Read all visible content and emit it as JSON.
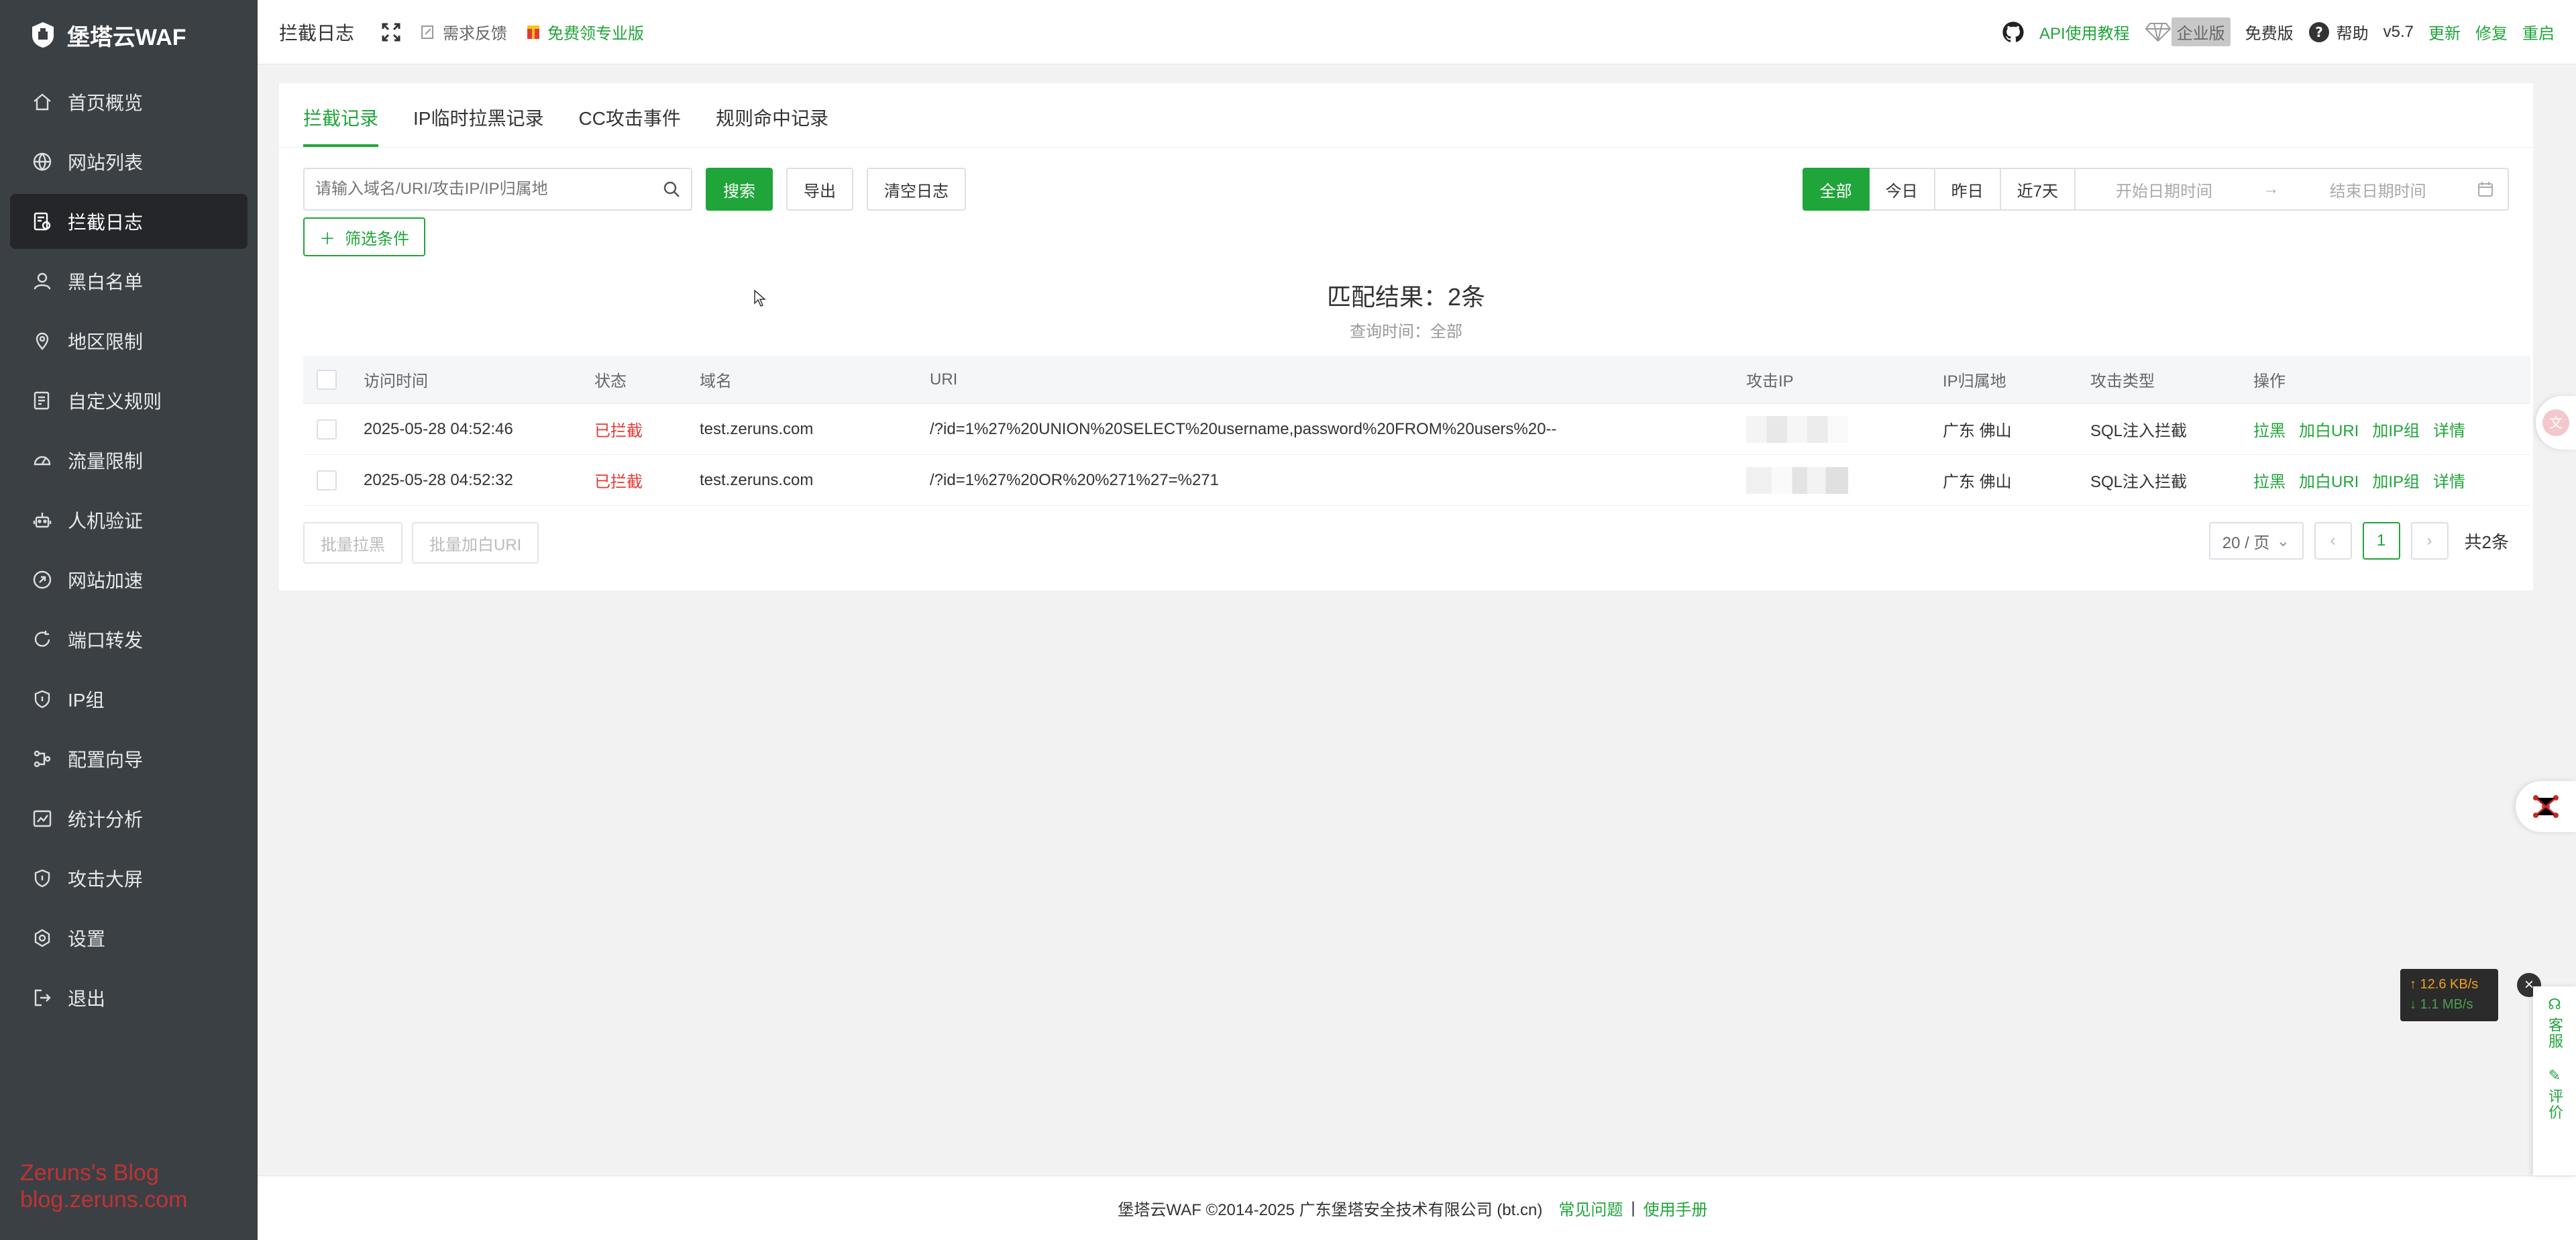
{
  "brand": {
    "name": "堡塔云WAF"
  },
  "sidebar": {
    "items": [
      {
        "label": "首页概览",
        "icon": "home-icon"
      },
      {
        "label": "网站列表",
        "icon": "globe-icon"
      },
      {
        "label": "拦截日志",
        "icon": "log-icon",
        "active": true
      },
      {
        "label": "黑白名单",
        "icon": "user-icon"
      },
      {
        "label": "地区限制",
        "icon": "location-icon"
      },
      {
        "label": "自定义规则",
        "icon": "edit-doc-icon"
      },
      {
        "label": "流量限制",
        "icon": "gauge-icon"
      },
      {
        "label": "人机验证",
        "icon": "robot-icon"
      },
      {
        "label": "网站加速",
        "icon": "rocket-icon"
      },
      {
        "label": "端口转发",
        "icon": "refresh-icon"
      },
      {
        "label": "IP组",
        "icon": "shield-icon"
      },
      {
        "label": "配置向导",
        "icon": "flow-icon"
      },
      {
        "label": "统计分析",
        "icon": "chart-icon"
      },
      {
        "label": "攻击大屏",
        "icon": "shield-icon"
      },
      {
        "label": "设置",
        "icon": "gear-icon"
      },
      {
        "label": "退出",
        "icon": "logout-icon"
      }
    ],
    "watermark": [
      "Zeruns's Blog",
      "blog.zeruns.com"
    ]
  },
  "topbar": {
    "title": "拦截日志",
    "feedback": "需求反馈",
    "free_pro": "免费领专业版",
    "api_tutorial": "API使用教程",
    "enterprise": "企业版",
    "free_edition": "免费版",
    "help": "帮助",
    "version": "v5.7",
    "update": "更新",
    "repair": "修复",
    "restart": "重启"
  },
  "tabs": [
    "拦截记录",
    "IP临时拉黑记录",
    "CC攻击事件",
    "规则命中记录"
  ],
  "toolbar": {
    "search_placeholder": "请输入域名/URI/攻击IP/IP归属地",
    "search": "搜索",
    "export": "导出",
    "clear": "清空日志",
    "filter": "筛选条件",
    "ranges": [
      "全部",
      "今日",
      "昨日",
      "近7天"
    ],
    "start_placeholder": "开始日期时间",
    "end_placeholder": "结束日期时间"
  },
  "summary": {
    "match": "匹配结果：2条",
    "query_time": "查询时间：全部"
  },
  "table": {
    "headers": [
      "访问时间",
      "状态",
      "域名",
      "URI",
      "攻击IP",
      "IP归属地",
      "攻击类型",
      "操作"
    ],
    "rows": [
      {
        "time": "2025-05-28 04:52:46",
        "status": "已拦截",
        "domain": "test.zeruns.com",
        "uri": "/?id=1%27%20UNION%20SELECT%20username,password%20FROM%20users%20--",
        "loc": "广东 佛山",
        "type": "SQL注入拦截"
      },
      {
        "time": "2025-05-28 04:52:32",
        "status": "已拦截",
        "domain": "test.zeruns.com",
        "uri": "/?id=1%27%20OR%20%271%27=%271",
        "loc": "广东 佛山",
        "type": "SQL注入拦截"
      }
    ],
    "ops": [
      "拉黑",
      "加白URI",
      "加IP组",
      "详情"
    ]
  },
  "bulk": {
    "block": "批量拉黑",
    "whitelist": "批量加白URI"
  },
  "pager": {
    "size": "20 / 页",
    "current": "1",
    "total": "共2条"
  },
  "footer": {
    "copyright": "堡塔云WAF ©2014-2025 广东堡塔安全技术有限公司 (bt.cn)",
    "faq": "常见问题",
    "sep": "|",
    "manual": "使用手册"
  },
  "speed": {
    "up": "↑ 12.6 KB/s",
    "down": "↓ 1.1 MB/s"
  },
  "side_tool": {
    "service": "客服",
    "review": "评价"
  },
  "colors": {
    "accent": "#20a53a",
    "sidebar": "#3b4045",
    "danger": "#e53935"
  }
}
